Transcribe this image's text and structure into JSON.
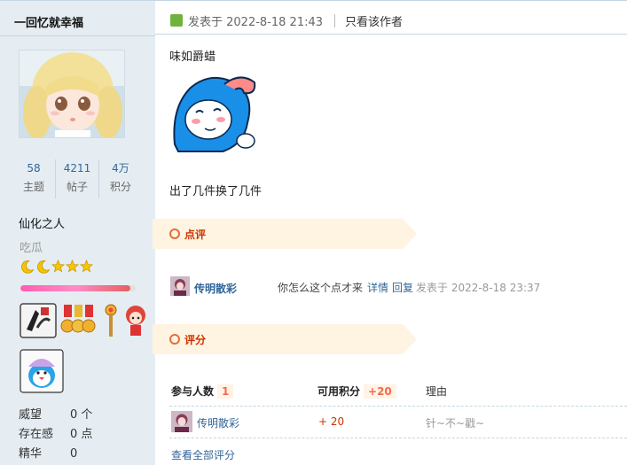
{
  "author": {
    "name": "一回忆就幸福",
    "stats": [
      {
        "value": "58",
        "label": "主题"
      },
      {
        "value": "4211",
        "label": "帖子"
      },
      {
        "value": "4万",
        "label": "积分"
      }
    ],
    "title": "仙化之人",
    "subtitle": "吃瓜",
    "level_progress": 0.95,
    "props": [
      {
        "key": "威望",
        "value": "0 个"
      },
      {
        "key": "存在感",
        "value": "0 点"
      },
      {
        "key": "精华",
        "value": "0"
      }
    ]
  },
  "post_header": {
    "posted_at": "发表于 2022-8-18 21:43",
    "only_author": "只看该作者"
  },
  "post": {
    "line1": "味如爵蜡",
    "line2": "出了几件换了几件"
  },
  "comments": {
    "section_label": "点评",
    "items": [
      {
        "user": "传明散彩",
        "text": "你怎么这个点才来",
        "detail": "详情",
        "reply": "回复",
        "time": "发表于 2022-8-18 23:37"
      }
    ]
  },
  "rating": {
    "section_label": "评分",
    "col_people": "参与人数",
    "people_count": "1",
    "col_points": "可用积分",
    "points_total": "+20",
    "col_reason": "理由",
    "rows": [
      {
        "user": "传明散彩",
        "score": "+ 20",
        "reason": "针~不~戳~"
      }
    ],
    "view_all": "查看全部评分"
  },
  "colors": {
    "link": "#336699",
    "accent_red": "#cc3300",
    "sidebar_bg": "#e5edf2",
    "section_bg": "#fff3e1"
  }
}
